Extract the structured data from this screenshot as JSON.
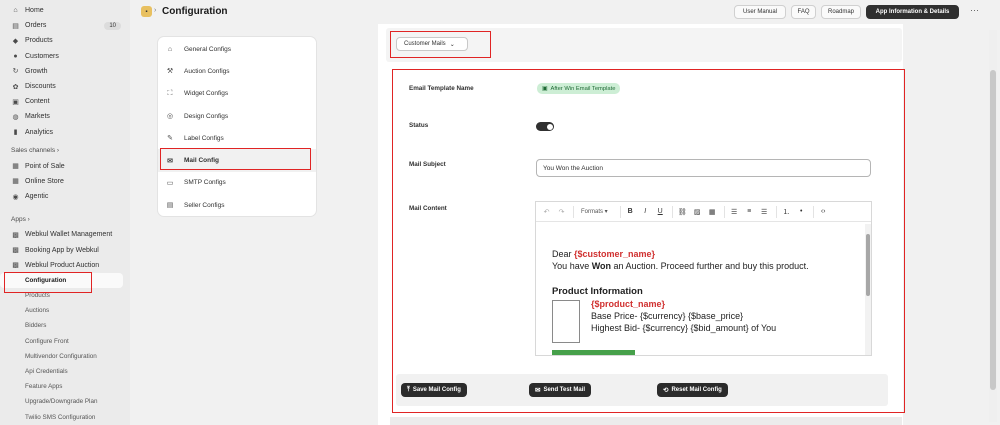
{
  "sidebar": {
    "items": [
      {
        "label": "Home",
        "icon": "home-icon",
        "glyph": "⌂"
      },
      {
        "label": "Orders",
        "icon": "orders-icon",
        "glyph": "▤",
        "badge": "10"
      },
      {
        "label": "Products",
        "icon": "tag-icon",
        "glyph": "◆"
      },
      {
        "label": "Customers",
        "icon": "person-icon",
        "glyph": "●"
      },
      {
        "label": "Growth",
        "icon": "growth-icon",
        "glyph": "↻"
      },
      {
        "label": "Discounts",
        "icon": "discount-icon",
        "glyph": "✿"
      },
      {
        "label": "Content",
        "icon": "content-icon",
        "glyph": "▣"
      },
      {
        "label": "Markets",
        "icon": "globe-icon",
        "glyph": "◍"
      },
      {
        "label": "Analytics",
        "icon": "analytics-icon",
        "glyph": "▮"
      }
    ],
    "sales_channels_label": "Sales channels ›",
    "channels": [
      {
        "label": "Point of Sale",
        "icon": "pos-icon",
        "glyph": "▦"
      },
      {
        "label": "Online Store",
        "icon": "store-icon",
        "glyph": "▦"
      },
      {
        "label": "Agentic",
        "icon": "agentic-icon",
        "glyph": "◉"
      }
    ],
    "apps_label": "Apps ›",
    "apps": [
      {
        "label": "Webkul Wallet Management",
        "icon": "wallet-app-icon",
        "glyph": "▩"
      },
      {
        "label": "Booking App by Webkul",
        "icon": "booking-app-icon",
        "glyph": "▩"
      },
      {
        "label": "Webkul Product Auction",
        "icon": "auction-app-icon",
        "glyph": "▩"
      }
    ],
    "sub_items": [
      "Configuration",
      "Products",
      "Auctions",
      "Bidders",
      "Configure Front",
      "Multivendor Configuration",
      "Api Credentials",
      "Feature Apps",
      "Upgrade/Downgrade Plan",
      "Twilio SMS Configuration"
    ]
  },
  "header": {
    "title": "Configuration",
    "buttons": [
      "User Manual",
      "FAQ",
      "Roadmap",
      "App Information & Details"
    ],
    "more": "···"
  },
  "config_nav": {
    "items": [
      {
        "label": "General Configs",
        "icon": "home-icon",
        "glyph": "⌂"
      },
      {
        "label": "Auction Configs",
        "icon": "hammer-icon",
        "glyph": "⚒"
      },
      {
        "label": "Widget Configs",
        "icon": "widget-icon",
        "glyph": "⛶"
      },
      {
        "label": "Design Configs",
        "icon": "eye-icon",
        "glyph": "◎"
      },
      {
        "label": "Label Configs",
        "icon": "label-icon",
        "glyph": "✎"
      },
      {
        "label": "Mail Config",
        "icon": "mail-icon",
        "glyph": "✉"
      },
      {
        "label": "SMTP Configs",
        "icon": "smtp-icon",
        "glyph": "▭"
      },
      {
        "label": "Seller Configs",
        "icon": "seller-icon",
        "glyph": "▤"
      }
    ]
  },
  "mail_select": {
    "value": "Customer Mails"
  },
  "form": {
    "template_name_label": "Email Template Name",
    "template_badge": "After Win Email Template",
    "status_label": "Status",
    "subject_label": "Mail Subject",
    "subject_value": "You Won the Auction",
    "content_label": "Mail Content"
  },
  "editor": {
    "formats_label": "Formats ▾",
    "body": {
      "dear": "Dear ",
      "customer_var": "{$customer_name}",
      "won_pre": "You have ",
      "won_bold": "Won",
      "won_post": " an Auction. Proceed further and buy this product.",
      "product_heading": "Product Information",
      "product_var": "{$product_name}",
      "base_price": "Base Price- {$currency} {$base_price}",
      "highest_bid": "Highest Bid- {$currency} {$bid_amount} of You"
    }
  },
  "actions": {
    "save": "Save Mail Config",
    "test": "Send Test Mail",
    "reset": "Reset Mail Config"
  },
  "colors": {
    "annotation_red": "#e02424",
    "variable_red": "#d0302f",
    "badge_green": "#cdeed5",
    "button_dark": "#2b2b2b"
  }
}
